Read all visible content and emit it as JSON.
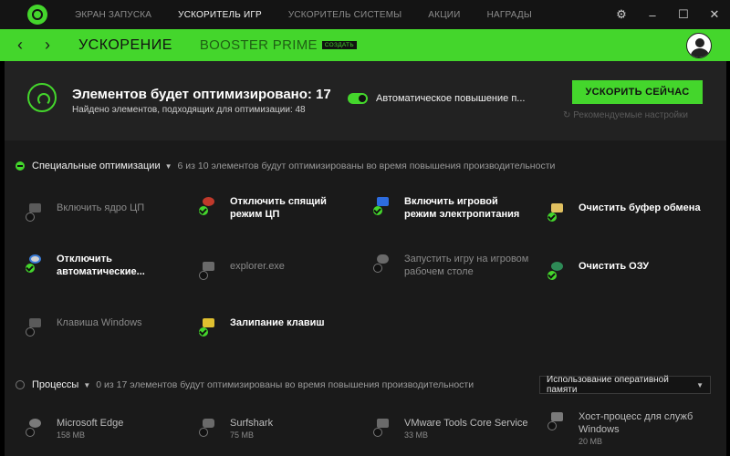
{
  "titlebar": {
    "tabs": [
      {
        "label": "ЭКРАН ЗАПУСКА",
        "active": false
      },
      {
        "label": "УСКОРИТЕЛЬ ИГР",
        "active": true
      },
      {
        "label": "УСКОРИТЕЛЬ СИСТЕМЫ",
        "active": false
      },
      {
        "label": "АКЦИИ",
        "active": false
      },
      {
        "label": "НАГРАДЫ",
        "active": false
      }
    ],
    "controls": [
      "gear-icon",
      "minimize-icon",
      "maximize-icon",
      "close-icon"
    ]
  },
  "subnav": {
    "title": "УСКОРЕНИЕ",
    "prime": "BOOSTER PRIME",
    "badge": "СОЗДАТЬ"
  },
  "summary": {
    "title": "Элементов будет оптимизировано: 17",
    "subtitle": "Найдено элементов, подходящих для оптимизации: 48",
    "toggle_label": "Автоматическое повышение п...",
    "toggle_on": true,
    "boost_button": "УСКОРИТЬ СЕЙЧАС",
    "recommended": "Рекомендуемые настройки"
  },
  "special": {
    "title": "Специальные оптимизации",
    "note": "6 из 10 элементов будут оптимизированы во время повышения производительности",
    "items": [
      {
        "label": "Включить ядро ЦП",
        "enabled": false
      },
      {
        "label": "Отключить спящий режим ЦП",
        "enabled": true
      },
      {
        "label": "Включить игровой режим электропитания",
        "enabled": true
      },
      {
        "label": "Очистить буфер обмена",
        "enabled": true
      },
      {
        "label": "Отключить автоматические...",
        "enabled": true
      },
      {
        "label": "explorer.exe",
        "enabled": false
      },
      {
        "label": "Запустить игру на игровом рабочем столе",
        "enabled": false
      },
      {
        "label": "Очистить ОЗУ",
        "enabled": true
      },
      {
        "label": "Клавиша Windows",
        "enabled": false
      },
      {
        "label": "Залипание клавиш",
        "enabled": true
      }
    ]
  },
  "processes": {
    "title": "Процессы",
    "note": "0 из 17 элементов будут оптимизированы во время повышения производительности",
    "sort": "Использование оперативной памяти",
    "items": [
      {
        "name": "Microsoft Edge",
        "size": "158 MB"
      },
      {
        "name": "Surfshark",
        "size": "75 MB"
      },
      {
        "name": "VMware Tools Core Service",
        "size": "33 MB"
      },
      {
        "name": "Хост-процесс для служб Windows",
        "size": "20 MB"
      }
    ]
  },
  "colors": {
    "accent": "#44d62c",
    "background": "#1a1a1a",
    "titlebar": "#141414"
  }
}
